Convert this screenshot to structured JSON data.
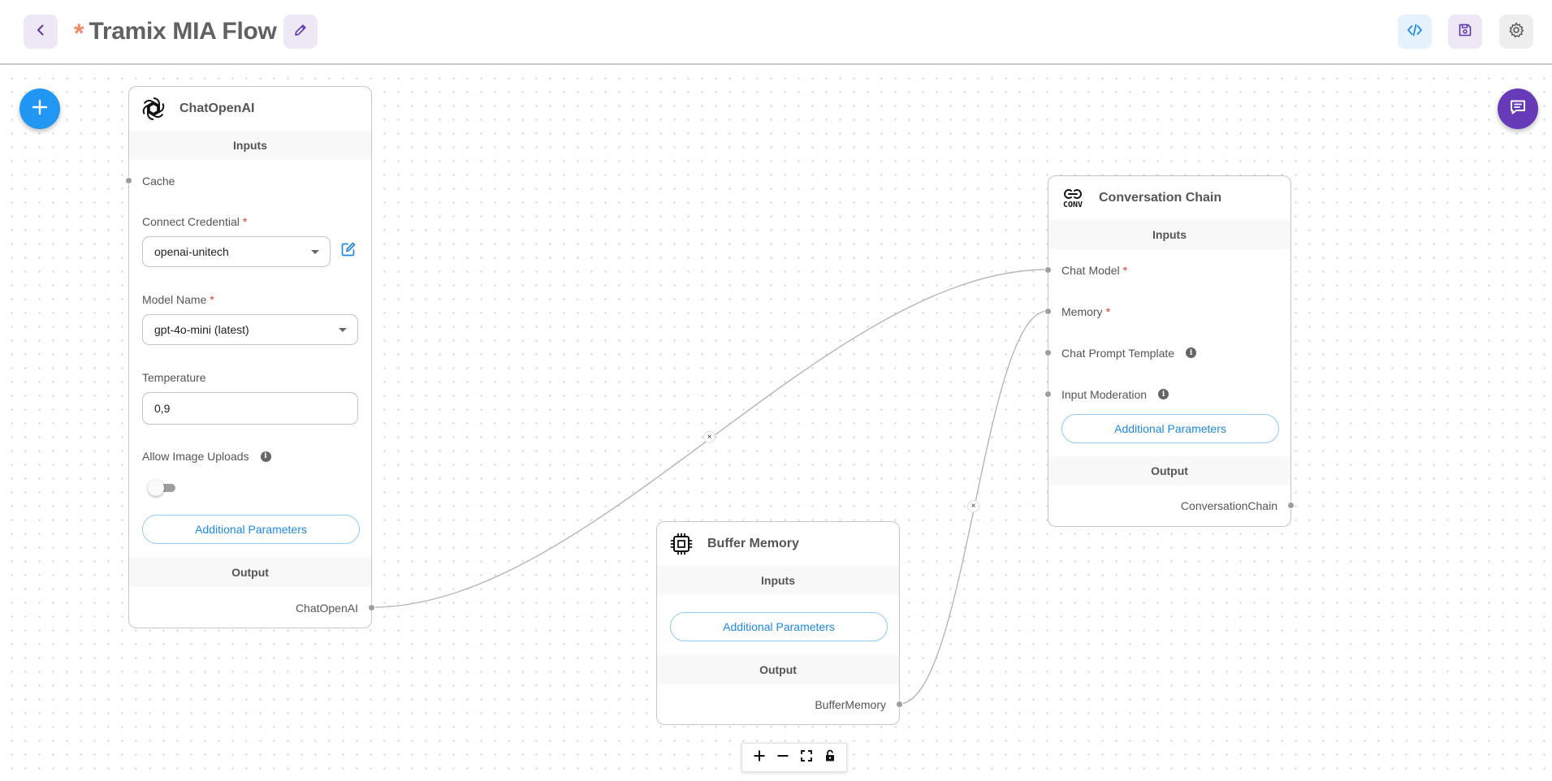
{
  "header": {
    "dirty_marker": "*",
    "title": "Tramix MIA Flow",
    "icons": {
      "back": "chevron-left-icon",
      "edit": "pencil-icon",
      "code": "code-icon",
      "save": "save-icon",
      "settings": "gear-icon"
    }
  },
  "colors": {
    "accent_blue": "#2196f3",
    "accent_purple": "#673ab7",
    "dirty_marker": "#f2896b",
    "required": "#e53935",
    "edge": "#b1b1b7"
  },
  "nodes": {
    "chatopenai": {
      "title": "ChatOpenAI",
      "icon": "openai-icon",
      "inputs_label": "Inputs",
      "cache_label": "Cache",
      "credential_label": "Connect Credential",
      "credential_value": "openai-unitech",
      "model_label": "Model Name",
      "model_value": "gpt-4o-mini (latest)",
      "temperature_label": "Temperature",
      "temperature_value": "0,9",
      "image_uploads_label": "Allow Image Uploads",
      "image_uploads_enabled": false,
      "additional_label": "Additional Parameters",
      "output_label": "Output",
      "output_value": "ChatOpenAI"
    },
    "conversation_chain": {
      "title": "Conversation Chain",
      "icon_text": "CONV",
      "inputs_label": "Inputs",
      "chat_model_label": "Chat Model",
      "memory_label": "Memory",
      "prompt_label": "Chat Prompt Template",
      "moderation_label": "Input Moderation",
      "additional_label": "Additional Parameters",
      "output_label": "Output",
      "output_value": "ConversationChain"
    },
    "buffer_memory": {
      "title": "Buffer Memory",
      "icon": "chip-icon",
      "inputs_label": "Inputs",
      "additional_label": "Additional Parameters",
      "output_label": "Output",
      "output_value": "BufferMemory"
    }
  },
  "required_marker": "*",
  "info_marker": "i",
  "edge_delete_marker": "×",
  "controls": {
    "zoom_in": "plus-icon",
    "zoom_out": "minus-icon",
    "fit_view": "fit-view-icon",
    "lock": "lock-icon"
  }
}
